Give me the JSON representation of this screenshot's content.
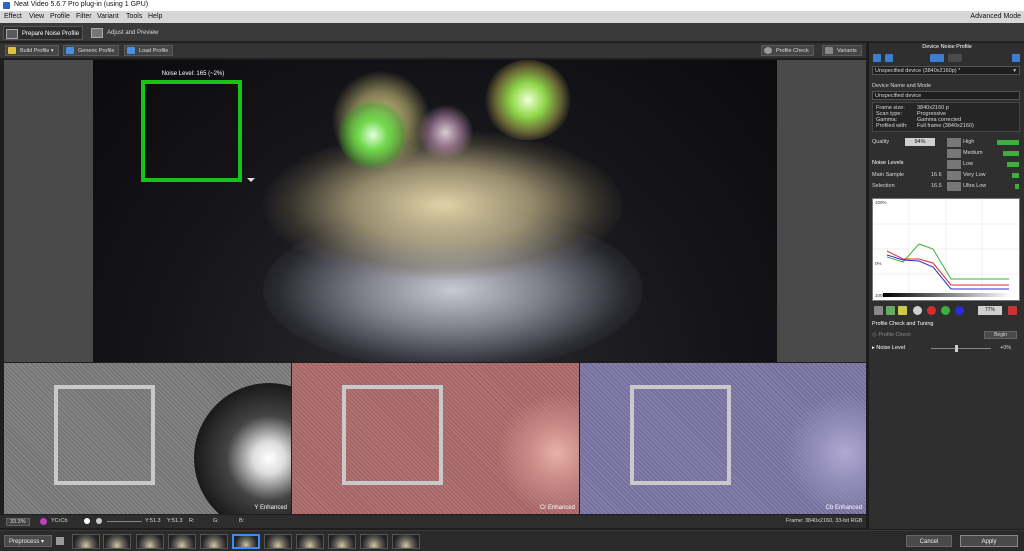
{
  "window": {
    "title": "Neat Video 5.6.7 Pro plug-in (using 1 GPU)"
  },
  "menu": {
    "items": [
      "Effect",
      "View",
      "Profile",
      "Filter",
      "Variant",
      "Tools",
      "Help"
    ],
    "right_label": "Advanced Mode"
  },
  "modes": {
    "prepare": "Prepare Noise Profile",
    "adjust": "Adjust and Preview"
  },
  "toolbar": {
    "build": "Build Profile",
    "generic": "Generic Profile",
    "load": "Load Profile",
    "check": "Profile Check",
    "variants": "Variants"
  },
  "viewer": {
    "noise_level": "Noise Level: 165 (~2%)"
  },
  "channels": [
    {
      "label": "Y Enhanced"
    },
    {
      "label": "Cr Enhanced"
    },
    {
      "label": "Cb Enhanced"
    }
  ],
  "infobar": {
    "zoom": "33.3%",
    "colorspace": "YCrCb",
    "y": "Y:51.3",
    "y2": "Y:51.3",
    "r": "R:",
    "g": "G:",
    "b": "B:",
    "frame": "Frame: 3840x2160, 33-bit RGB"
  },
  "footer": {
    "mode": "Preprocess",
    "cancel": "Cancel",
    "apply": "Apply"
  },
  "panel": {
    "device_title": "Device Noise Profile",
    "device_select": "Unspecified device (3840x2160p) *",
    "device_name_title": "Device Name and Mode",
    "device_name": "Unspecified device",
    "info_rows": [
      {
        "k": "Frame size:",
        "v": "3840x2160 p"
      },
      {
        "k": "Scan type:",
        "v": "Progressive"
      },
      {
        "k": "Gamma:",
        "v": "Gamma corrected"
      },
      {
        "k": "Profiled with:",
        "v": "Full frame (3840x2160)"
      }
    ],
    "quality_label": "Quality",
    "quality_value": "94%",
    "noise_levels_label": "Noise Levels",
    "main_sample_label": "Main Sample",
    "main_sample_value": "16.6",
    "selection_label": "Selection",
    "selection_value": "16.5",
    "freq_levels": [
      {
        "name": "High",
        "fill": 1.0
      },
      {
        "name": "Medium",
        "fill": 0.75
      },
      {
        "name": "Low",
        "fill": 0.55
      },
      {
        "name": "Very Low",
        "fill": 0.3
      },
      {
        "name": "Ultra Low",
        "fill": 0.2
      }
    ],
    "graph_top": "100%",
    "graph_mid": "0%",
    "graph_bottom": "100%",
    "graph_pct": "77%",
    "check_title": "Profile Check and Tuning",
    "profile_check": "Profile Check",
    "begin": "Begin",
    "noise_level_label": "Noise Level",
    "noise_level_value": "+0%"
  },
  "colors": {
    "noise_box": "#19c21a",
    "accent": "#3b8cff",
    "y_line": "#2c2cd8",
    "cr_line": "#d82c2c",
    "cb_line": "#3fae3f"
  }
}
